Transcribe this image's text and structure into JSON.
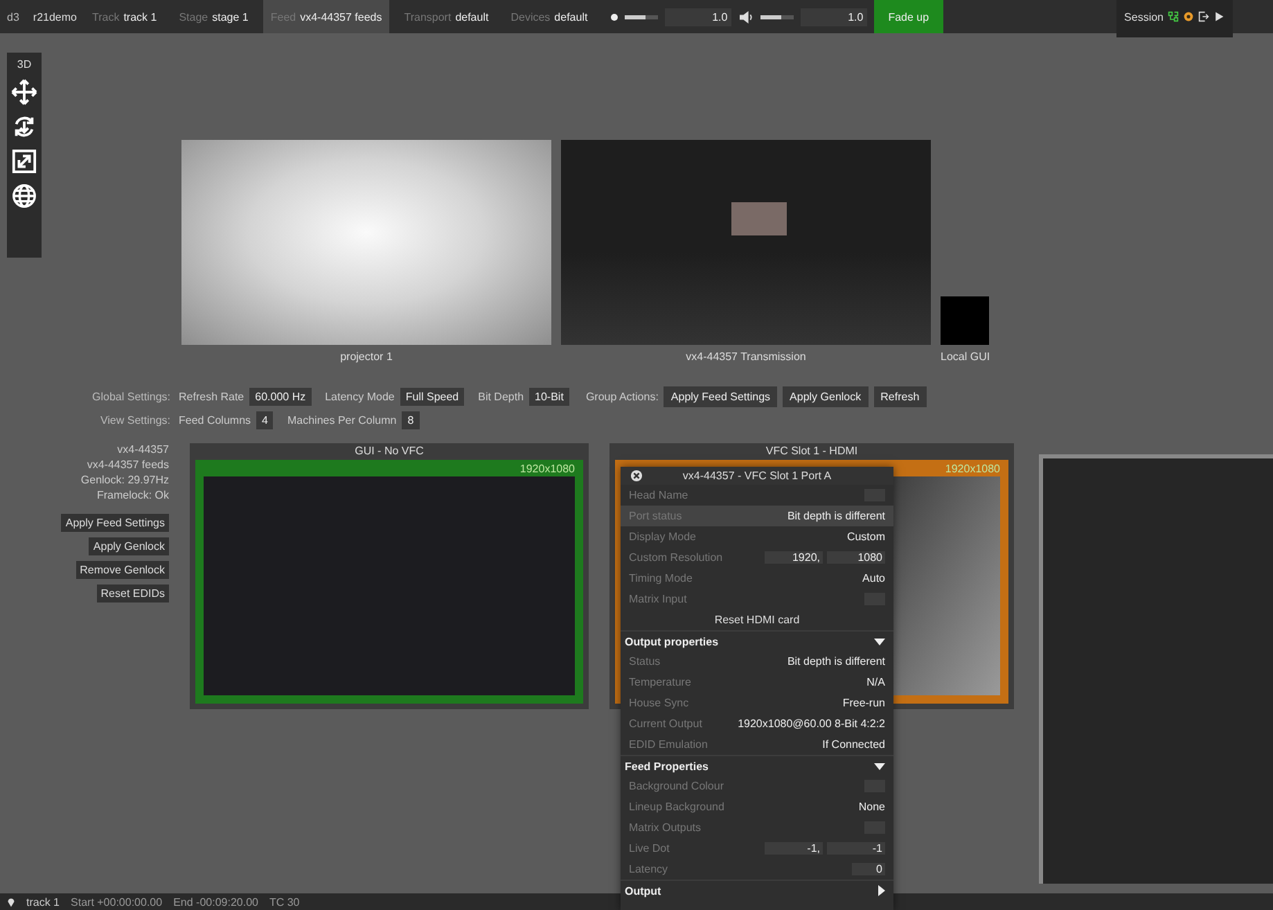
{
  "top_bar": {
    "logo": "d3",
    "project": "r21demo",
    "fields": [
      {
        "label": "Track",
        "value": "track 1",
        "selected": false
      },
      {
        "label": "Stage",
        "value": "stage 1",
        "selected": false
      },
      {
        "label": "Feed",
        "value": "vx4-44357 feeds",
        "selected": true
      },
      {
        "label": "Transport",
        "value": "default",
        "selected": false
      },
      {
        "label": "Devices",
        "value": "default",
        "selected": false
      }
    ],
    "brightness": {
      "level": 0.6,
      "reading": "1.0"
    },
    "volume": {
      "level": 0.6,
      "reading": "1.0"
    },
    "fade_button": "Fade up",
    "session": "Session"
  },
  "tools": {
    "label": "3D"
  },
  "previews": [
    {
      "kind": "projector",
      "label": "projector 1"
    },
    {
      "kind": "stage",
      "label": "vx4-44357 Transmission"
    },
    {
      "kind": "local",
      "label": "Local GUI"
    }
  ],
  "global_settings": {
    "label": "Global Settings:",
    "fields": [
      {
        "label": "Refresh Rate",
        "value": "60.000 Hz"
      },
      {
        "label": "Latency Mode",
        "value": "Full Speed"
      },
      {
        "label": "Bit Depth",
        "value": "10-Bit"
      }
    ],
    "group_actions": {
      "label": "Group Actions:",
      "buttons": [
        "Apply Feed Settings",
        "Apply Genlock",
        "Refresh"
      ]
    }
  },
  "view_settings": {
    "label": "View Settings:",
    "fields": [
      {
        "label": "Feed Columns",
        "value": "4"
      },
      {
        "label": "Machines Per Column",
        "value": "8"
      }
    ]
  },
  "machine": {
    "lines": [
      "vx4-44357",
      "vx4-44357 feeds",
      "Genlock: 29.97Hz",
      "Framelock: Ok"
    ],
    "buttons": [
      "Apply Feed Settings",
      "Apply Genlock",
      "Remove Genlock",
      "Reset EDIDs"
    ]
  },
  "feeds": [
    {
      "title": "GUI - No VFC",
      "resolution": "1920x1080",
      "color": "#1e7a1e",
      "kind": "blank"
    },
    {
      "title": "VFC Slot 1 - HDMI",
      "resolution": "1920x1080",
      "color": "#c46f14",
      "kind": "gradient"
    }
  ],
  "popup": {
    "title": "vx4-44357 - VFC Slot 1 Port A",
    "rows": [
      {
        "kind": "swatch",
        "label": "Head Name",
        "selected": false
      },
      {
        "kind": "text",
        "label": "Port status",
        "value": "Bit depth is different",
        "selected": true
      },
      {
        "kind": "text",
        "label": "Display Mode",
        "value": "Custom",
        "selected": false
      },
      {
        "kind": "dual",
        "label": "Custom Resolution",
        "values": [
          "1920,",
          "1080"
        ],
        "selected": false
      },
      {
        "kind": "text",
        "label": "Timing Mode",
        "value": "Auto",
        "selected": false
      },
      {
        "kind": "swatch",
        "label": "Matrix Input",
        "selected": false
      },
      {
        "kind": "button",
        "label": "Reset HDMI card"
      },
      {
        "kind": "section",
        "label": "Output properties",
        "expanded": true
      },
      {
        "kind": "text",
        "label": "Status",
        "value": "Bit depth is different",
        "selected": false
      },
      {
        "kind": "text",
        "label": "Temperature",
        "value": "N/A",
        "selected": false
      },
      {
        "kind": "text",
        "label": "House Sync",
        "value": "Free-run",
        "selected": false
      },
      {
        "kind": "text",
        "label": "Current Output",
        "value": "1920x1080@60.00 8-Bit  4:2:2",
        "selected": false
      },
      {
        "kind": "text",
        "label": "EDID Emulation",
        "value": "If Connected",
        "selected": false
      },
      {
        "kind": "section",
        "label": "Feed Properties",
        "expanded": true
      },
      {
        "kind": "swatch",
        "label": "Background Colour",
        "selected": false
      },
      {
        "kind": "text",
        "label": "Lineup Background",
        "value": "None",
        "selected": false
      },
      {
        "kind": "swatch",
        "label": "Matrix Outputs",
        "selected": false
      },
      {
        "kind": "dual",
        "label": "Live Dot",
        "values": [
          "-1,",
          "-1"
        ],
        "selected": false
      },
      {
        "kind": "field",
        "label": "Latency",
        "value": "0",
        "selected": false
      },
      {
        "kind": "section",
        "label": "Output",
        "expanded": false
      }
    ]
  },
  "status_bar": {
    "track": "track 1",
    "items": [
      "Start +00:00:00.00",
      "End -00:09:20.00",
      "TC 30"
    ]
  }
}
